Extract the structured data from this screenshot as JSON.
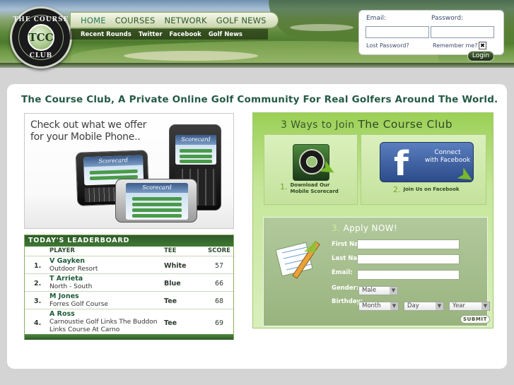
{
  "logo": {
    "top": "THE COURSE",
    "bottom": "CLUB",
    "mark": "TCC"
  },
  "nav": {
    "items": [
      "HOME",
      "COURSES",
      "NETWORK",
      "GOLF NEWS"
    ]
  },
  "subnav": {
    "items": [
      "Recent Rounds",
      "Twitter",
      "Facebook",
      "Golf News"
    ]
  },
  "login": {
    "email_label": "Email:",
    "password_label": "Password:",
    "lost": "Lost Password?",
    "remember": "Remember me?",
    "button": "Login"
  },
  "main": {
    "title": "The Course Club, A Private Online Golf Community For Real Golfers Around The World."
  },
  "mobile": {
    "line1": "Check out what we offer",
    "line2": "for your Mobile Phone..",
    "screen_title": "Scorecard"
  },
  "leaderboard": {
    "title": "TODAY'S LEADERBOARD",
    "headers": {
      "player": "PLAYER",
      "tee": "TEE",
      "score": "SCORE"
    },
    "rows": [
      {
        "rank": "1.",
        "name": "V Gayken",
        "course": "Outdoor Resort",
        "tee": "White",
        "score": "57"
      },
      {
        "rank": "2.",
        "name": "T Arrieta",
        "course": "North - South",
        "tee": "Blue",
        "score": "66"
      },
      {
        "rank": "3.",
        "name": "M Jones",
        "course": "Forres Golf Course",
        "tee": "Tee",
        "score": "68"
      },
      {
        "rank": "4.",
        "name": "A Ross",
        "course": "Carnoustie Golf Links The Buddon Links Course At Carno",
        "tee": "Tee",
        "score": "69"
      }
    ]
  },
  "join": {
    "title_prefix": "3 Ways to Join",
    "title_brand": "The Course Club",
    "step1_num": "1.",
    "step1_line1": "Download Our",
    "step1_line2": "Mobile Scorecard",
    "step2_num": "2.",
    "step2_text": "Join Us on Facebook",
    "fb_line1": "Connect",
    "fb_line2": "with Facebook",
    "app_logo_text": "THE COURSE CLUB"
  },
  "apply": {
    "num": "3.",
    "title": "Apply NOW!",
    "first": "First Name:",
    "last": "Last Name:",
    "email": "Email:",
    "gender": "Gender:",
    "birthday": "Birthday:",
    "gender_value": "Male",
    "month": "Month",
    "day": "Day",
    "year": "Year",
    "submit": "SUBMIT"
  },
  "colors": {
    "brand_green": "#245a45",
    "facebook": "#3b5998",
    "accent_green": "#7ab82a"
  }
}
